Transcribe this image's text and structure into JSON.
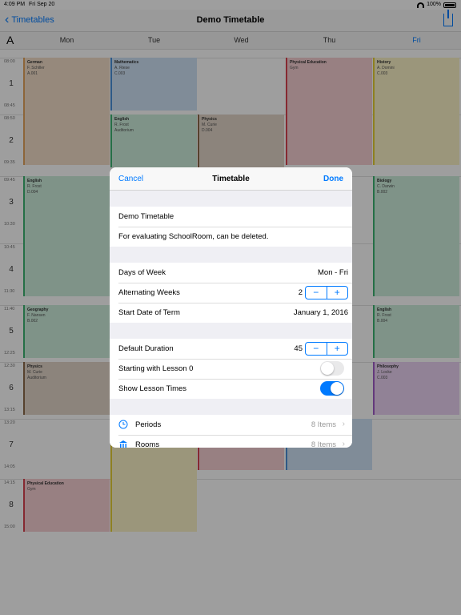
{
  "status": {
    "time": "4:09 PM",
    "date": "Fri Sep 20",
    "battery": "100%"
  },
  "nav": {
    "back_label": "Timetables",
    "title": "Demo Timetable"
  },
  "days": {
    "a_label": "A",
    "labels": [
      "Mon",
      "Tue",
      "Wed",
      "Thu",
      "Fri"
    ],
    "selected": "Fri"
  },
  "periods": [
    {
      "num": "1",
      "start": "08:00",
      "end": "08:45"
    },
    {
      "num": "2",
      "start": "08:50",
      "end": "09:35"
    },
    {
      "num": "3",
      "start": "09:45",
      "end": "10:30"
    },
    {
      "num": "4",
      "start": "10:45",
      "end": "11:30"
    },
    {
      "num": "5",
      "start": "11:40",
      "end": "12:25"
    },
    {
      "num": "6",
      "start": "12:30",
      "end": "13:15"
    },
    {
      "num": "7",
      "start": "13:20",
      "end": "14:05"
    },
    {
      "num": "8",
      "start": "14:15",
      "end": "15:00"
    }
  ],
  "lessons": [
    {
      "subject": "German",
      "teacher": "F. Schiller",
      "room": "A.001"
    },
    {
      "subject": "Mathematics",
      "teacher": "A. Riese",
      "room": "C.003"
    },
    {
      "subject": "Physical Education",
      "teacher": "",
      "room": "Gym"
    },
    {
      "subject": "History",
      "teacher": "A. Domini",
      "room": "C.003"
    },
    {
      "subject": "English",
      "teacher": "R. Frost",
      "room": "Auditorium"
    },
    {
      "subject": "Physics",
      "teacher": "M. Curie",
      "room": "D.004"
    },
    {
      "subject": "English",
      "teacher": "R. Frost",
      "room": "D.004"
    },
    {
      "subject": "Biology",
      "teacher": "C. Darwin",
      "room": "B.002"
    },
    {
      "subject": "Geography",
      "teacher": "F. Nansen",
      "room": "B.002"
    },
    {
      "subject": "English",
      "teacher": "R. Frost",
      "room": "B.004"
    },
    {
      "subject": "Physics",
      "teacher": "M. Curie",
      "room": "Auditorium"
    },
    {
      "subject": "Philosophy",
      "teacher": "J. Locke",
      "room": "C.003"
    },
    {
      "subject": "Physical Education",
      "teacher": "",
      "room": "Gym"
    }
  ],
  "colors": {
    "accent": "#007aff"
  },
  "modal": {
    "cancel_label": "Cancel",
    "title": "Timetable",
    "done_label": "Done",
    "name_value": "Demo Timetable",
    "description_value": "For evaluating SchoolRoom, can be deleted.",
    "days_of_week": {
      "label": "Days of Week",
      "value": "Mon - Fri"
    },
    "alternating_weeks": {
      "label": "Alternating Weeks",
      "value": "2"
    },
    "start_date": {
      "label": "Start Date of Term",
      "value": "January 1, 2016"
    },
    "default_duration": {
      "label": "Default Duration",
      "value": "45"
    },
    "start_lesson_zero": {
      "label": "Starting with Lesson 0",
      "on": false
    },
    "show_lesson_times": {
      "label": "Show Lesson Times",
      "on": true
    },
    "stepper_minus": "−",
    "stepper_plus": "+",
    "periods_row": {
      "label": "Periods",
      "value": "8 Items",
      "icon": "clock-icon"
    },
    "rooms_row": {
      "label": "Rooms",
      "value": "8 Items",
      "icon": "building-icon"
    }
  }
}
